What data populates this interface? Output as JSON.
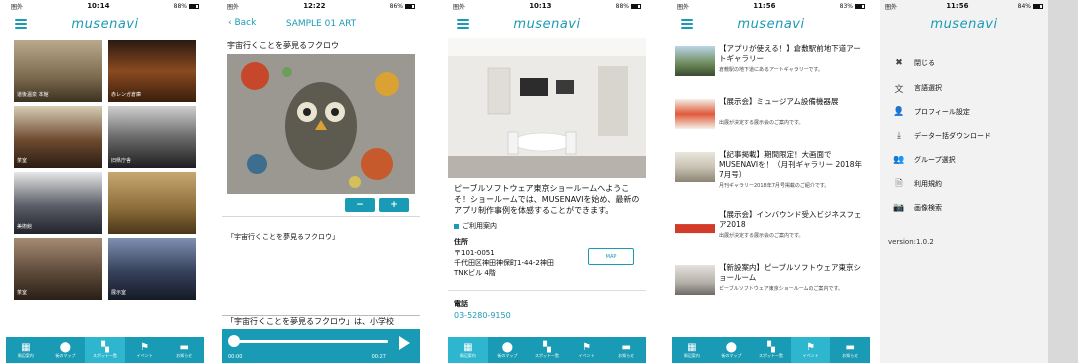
{
  "status": {
    "carrier": "圏外",
    "screens": [
      {
        "time": "10:14",
        "battery": "88%"
      },
      {
        "time": "12:22",
        "battery": "86%"
      },
      {
        "time": "10:13",
        "battery": "88%"
      },
      {
        "time": "11:56",
        "battery": "83%"
      },
      {
        "time": "11:56",
        "battery": "84%"
      }
    ]
  },
  "logo": "musenavi",
  "tabs": [
    "周辺案内",
    "街のマップ",
    "スポット一覧",
    "イベント",
    "お知らせ"
  ],
  "screen1": {
    "tiles": [
      {
        "label": "道後温泉 本館",
        "color": "#7d6a4e"
      },
      {
        "label": "赤レンガ倉庫",
        "color": "#6b3e1c"
      },
      {
        "label": "茶室",
        "color": "#4f3422"
      },
      {
        "label": "旧県庁舎",
        "color": "#3a3a3a"
      },
      {
        "label": "美術館",
        "color": "#3c3f4a"
      },
      {
        "label": "",
        "color": "#8a6b3a"
      },
      {
        "label": "茶室",
        "color": "#5e4a3a"
      },
      {
        "label": "展示室",
        "color": "#35405a"
      }
    ]
  },
  "screen2": {
    "back": "Back",
    "title": "SAMPLE 01 ART",
    "art_title": "宇宙行くことを夢見るフクロウ",
    "zoom_out": "−",
    "zoom_in": "+",
    "caption": "「宇宙行くことを夢見るフクロウ」",
    "description": "「宇宙行くことを夢見るフクロウ」は、小学校",
    "time_start": "00:00",
    "time_end": "00:27"
  },
  "screen3": {
    "intro": "ピーブルソフトウェア東京ショールームへようこそ！ショールームでは、MUSENAVIを始め、最新のアプリ制作事例を体感することができます。",
    "section": "ご利用案内",
    "address_label": "住所",
    "address": "〒101-0051\n千代田区神田神保町1-44-2神田\nTNKビル 4階",
    "map_button": "MAP",
    "phone_label": "電話",
    "phone": "03-5280-9150"
  },
  "screen4": {
    "news": [
      {
        "title": "【アプリが使える！】倉敷駅前地下道アートギャラリー",
        "sub": "倉敷駅の地下道にあるアートギャラリーです。"
      },
      {
        "title": "【展示会】ミュージアム設備機器展",
        "sub": "出展が決定する展示会のご案内です。"
      },
      {
        "title": "【記事掲載】期間限定！大画面でMUSENAVIを！（月刊ギャラリー 2018年7月号）",
        "sub": "月刊ギャラリー2018年7月号掲載のご紹介です。"
      },
      {
        "title": "【展示会】インバウンド受入ビジネスフェア2018",
        "sub": "出展が決定する展示会のご案内です。"
      },
      {
        "title": "【新設案内】ピーブルソフトウェア東京ショールーム",
        "sub": "ピーブルソフトウェア東京ショールームのご案内です。"
      }
    ]
  },
  "screen5": {
    "menu": [
      {
        "icon": "close-icon",
        "glyph": "✖",
        "label": "閉じる"
      },
      {
        "icon": "language-icon",
        "glyph": "文",
        "label": "言語選択"
      },
      {
        "icon": "user-icon",
        "glyph": "👤",
        "label": "プロフィール設定"
      },
      {
        "icon": "download-icon",
        "glyph": "⤓",
        "label": "データー括ダウンロード"
      },
      {
        "icon": "group-icon",
        "glyph": "👥",
        "label": "グループ選択"
      },
      {
        "icon": "document-icon",
        "glyph": "🗎",
        "label": "利用規約"
      },
      {
        "icon": "camera-icon",
        "glyph": "📷",
        "label": "画像検索"
      }
    ],
    "version": "version:1.0.2"
  }
}
